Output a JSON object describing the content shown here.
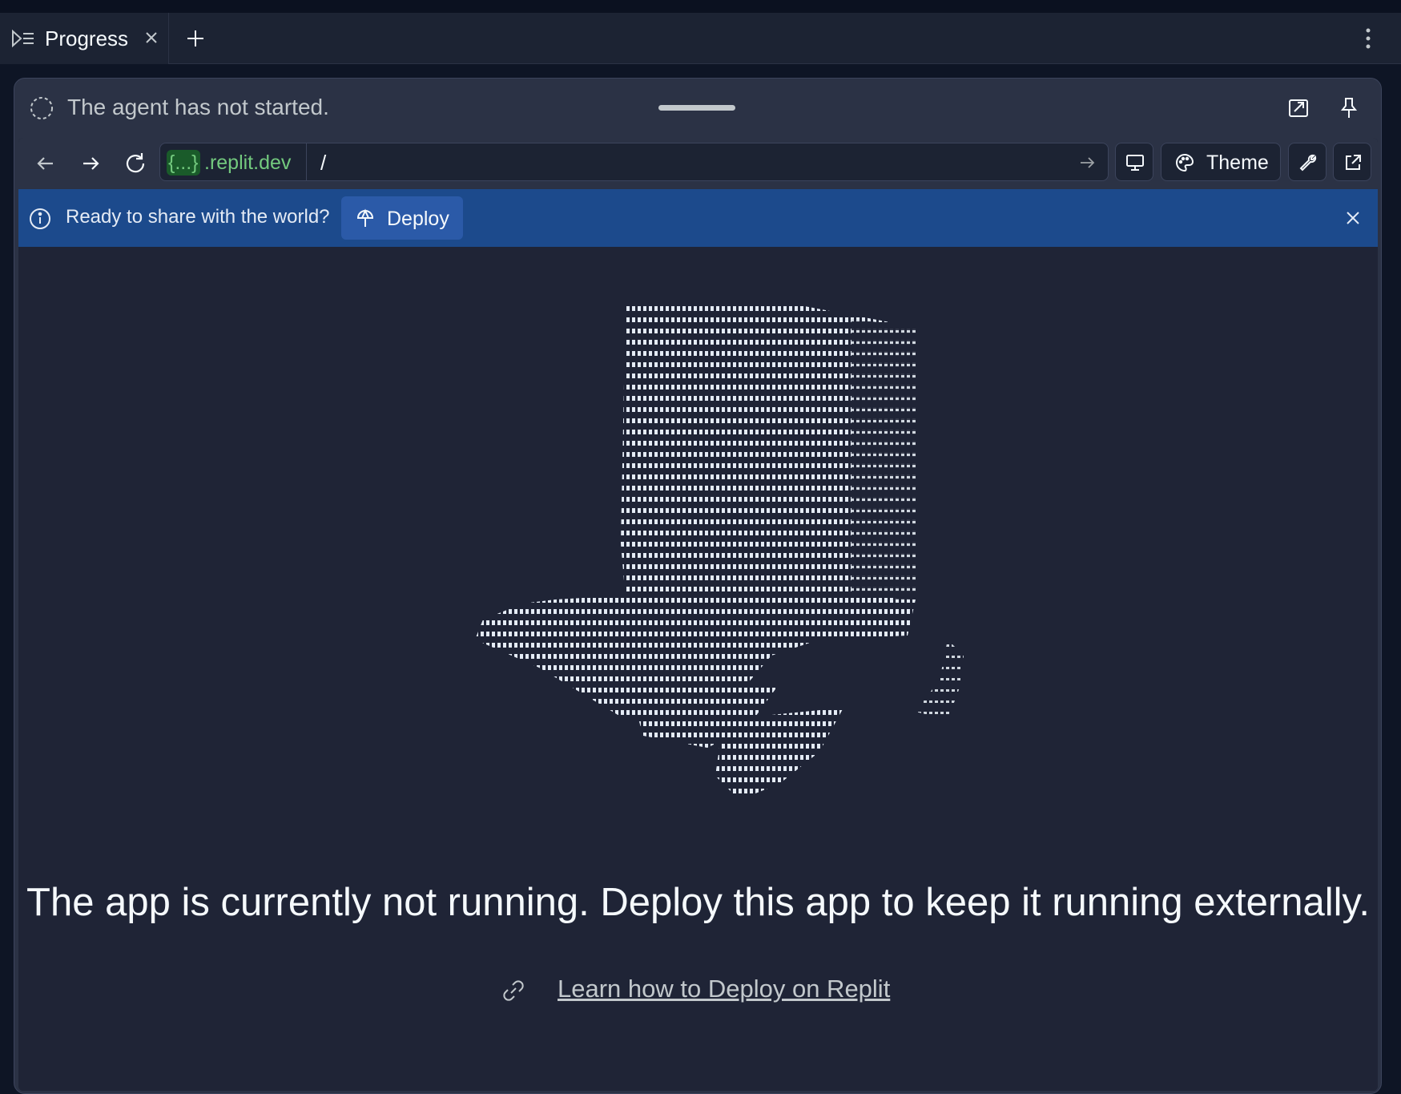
{
  "tab": {
    "label": "Progress",
    "icon": "progress-icon"
  },
  "status": {
    "text": "The agent has not started."
  },
  "address_bar": {
    "domain_pill": "{...}",
    "domain_suffix": ".replit.dev",
    "path": "/"
  },
  "toolbar": {
    "theme_label": "Theme"
  },
  "banner": {
    "message": "Ready to share with the world?",
    "deploy_label": "Deploy"
  },
  "main": {
    "headline": "The app is currently not running. Deploy this app to keep it running externally.",
    "learn_link": "Learn how to Deploy on Replit",
    "illustration": "ascii-art-top-hat"
  },
  "colors": {
    "background": "#1c2333",
    "banner": "#1c4a8c",
    "deploy_button": "#2b5aa8",
    "domain": "#73c97e"
  }
}
